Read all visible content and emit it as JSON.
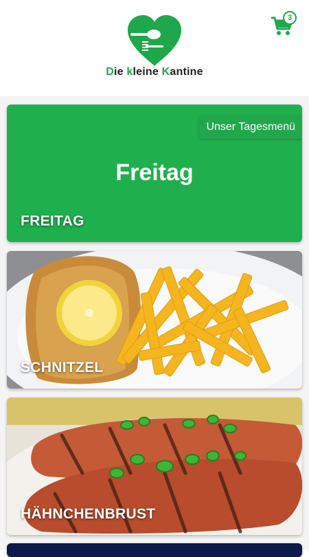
{
  "header": {
    "brand_parts": [
      {
        "letter": "D",
        "rest": "ie "
      },
      {
        "letter": "k",
        "rest": "leine "
      },
      {
        "letter": "K",
        "rest": "antine"
      }
    ],
    "cart_count": "3",
    "accent_color": "#1fa84b"
  },
  "cards": [
    {
      "ribbon": "Unser Tagesmenü",
      "center_title": "Freitag",
      "label": "FREITAG"
    },
    {
      "label": "SCHNITZEL"
    },
    {
      "label": "HÄHNCHENBRUST"
    }
  ]
}
